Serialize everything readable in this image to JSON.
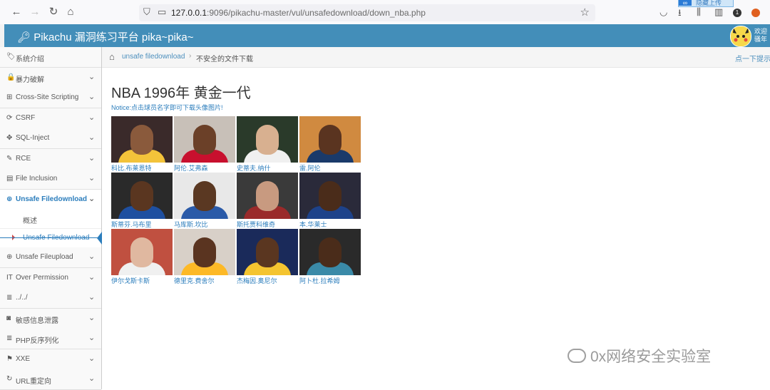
{
  "browser": {
    "url_host": "127.0.0.1",
    "url_rest": ":9096/pikachu-master/vul/unsafedownload/down_nba.php",
    "float_label": "隐藏上传"
  },
  "header": {
    "app_title": "Pikachu 漏洞练习平台 pika~pika~",
    "user_line1": "欢迎",
    "user_line2": "骚年"
  },
  "sidebar": {
    "items": [
      {
        "label": "系统介绍",
        "icon": "tag-icon",
        "glyph": "🏷",
        "chev": false
      },
      {
        "label": "暴力破解",
        "icon": "lock-icon",
        "glyph": "🔒",
        "chev": true
      },
      {
        "label": "Cross-Site Scripting",
        "icon": "sitemap-icon",
        "glyph": "⊞",
        "chev": true
      },
      {
        "label": "CSRF",
        "icon": "refresh-icon",
        "glyph": "⟳",
        "chev": true
      },
      {
        "label": "SQL-Inject",
        "icon": "arrows-icon",
        "glyph": "✥",
        "chev": true
      },
      {
        "label": "RCE",
        "icon": "pencil-icon",
        "glyph": "✎",
        "chev": true
      },
      {
        "label": "File Inclusion",
        "icon": "file-icon",
        "glyph": "▤",
        "chev": true
      },
      {
        "label": "Unsafe Filedownload",
        "icon": "download-icon",
        "glyph": "⊕",
        "chev": true,
        "active": true
      },
      {
        "label": "Unsafe Fileupload",
        "icon": "upload-icon",
        "glyph": "⊕",
        "chev": true
      },
      {
        "label": "Over Permission",
        "icon": "text-height-icon",
        "glyph": "IT",
        "chev": true
      },
      {
        "label": "../../",
        "icon": "align-left-icon",
        "glyph": "≣",
        "chev": true
      },
      {
        "label": "敏感信息泄露",
        "icon": "camera-icon",
        "glyph": "◙",
        "chev": true
      },
      {
        "label": "PHP反序列化",
        "icon": "list-icon",
        "glyph": "≣",
        "chev": true
      },
      {
        "label": "XXE",
        "icon": "flag-icon",
        "glyph": "⚑",
        "chev": true
      },
      {
        "label": "URL重定向",
        "icon": "repeat-icon",
        "glyph": "↻",
        "chev": true
      }
    ],
    "sub_items": [
      "概述",
      "Unsafe Filedownload"
    ]
  },
  "breadcrumb": {
    "link": "unsafe filedownload",
    "current": "不安全的文件下载",
    "hint": "点一下提示~"
  },
  "main": {
    "title": "NBA 1996年 黄金一代",
    "notice": "Notice:点击球员名字即可下载头像图片!",
    "players": [
      {
        "name": "科比.布莱恩特",
        "bg": "#3a2a2a",
        "skin": "#8a5a3c",
        "jersey": "#f3c33a"
      },
      {
        "name": "阿伦.艾弗森",
        "bg": "#c8c0b8",
        "skin": "#6b4028",
        "jersey": "#c8102e"
      },
      {
        "name": "史蒂夫.纳什",
        "bg": "#2a3a2a",
        "skin": "#d8b090",
        "jersey": "#f0f0f0"
      },
      {
        "name": "雷.阿伦",
        "bg": "#d08a40",
        "skin": "#5a3420",
        "jersey": "#1a3a6a"
      },
      {
        "name": "斯蒂芬.马布里",
        "bg": "#2a2a2a",
        "skin": "#5a3620",
        "jersey": "#1e4fa0"
      },
      {
        "name": "马库斯.坎比",
        "bg": "#e8e8e8",
        "skin": "#5a3822",
        "jersey": "#2a5aa8"
      },
      {
        "name": "斯托贾科维奇",
        "bg": "#3a3a3a",
        "skin": "#c89a80",
        "jersey": "#9a2a2a"
      },
      {
        "name": "本.华莱士",
        "bg": "#2a2a3a",
        "skin": "#4a2c1a",
        "jersey": "#1d428a"
      },
      {
        "name": "伊尔戈斯卡斯",
        "bg": "#c05040",
        "skin": "#e0b8a0",
        "jersey": "#f0f0f0"
      },
      {
        "name": "德里克.费舍尔",
        "bg": "#d8d0c8",
        "skin": "#5a3420",
        "jersey": "#fdb927"
      },
      {
        "name": "杰梅因.奥尼尔",
        "bg": "#1a2a5a",
        "skin": "#5a3620",
        "jersey": "#f4c430"
      },
      {
        "name": "阿卜杜.拉希姆",
        "bg": "#2a2a2a",
        "skin": "#4a2c1a",
        "jersey": "#3a8aa8"
      }
    ]
  },
  "watermark": "0x网络安全实验室"
}
